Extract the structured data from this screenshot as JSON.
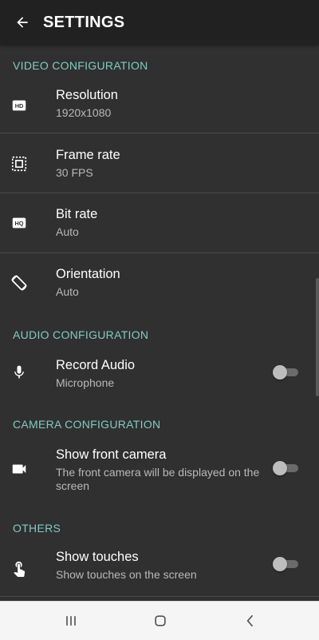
{
  "app_bar": {
    "title": "SETTINGS",
    "back_icon": "arrow-back-icon"
  },
  "sections": {
    "video": {
      "header": "VIDEO CONFIGURATION",
      "items": [
        {
          "title": "Resolution",
          "subtitle": "1920x1080",
          "icon": "hd-icon"
        },
        {
          "title": "Frame rate",
          "subtitle": "30 FPS",
          "icon": "frame-icon"
        },
        {
          "title": "Bit rate",
          "subtitle": "Auto",
          "icon": "hq-icon"
        },
        {
          "title": "Orientation",
          "subtitle": "Auto",
          "icon": "screen-rotation-icon"
        }
      ]
    },
    "audio": {
      "header": "AUDIO CONFIGURATION",
      "items": [
        {
          "title": "Record Audio",
          "subtitle": "Microphone",
          "icon": "mic-icon",
          "toggle": false
        }
      ]
    },
    "camera": {
      "header": "CAMERA CONFIGURATION",
      "items": [
        {
          "title": "Show front camera",
          "subtitle": "The front camera will be displayed on the screen",
          "icon": "videocam-icon",
          "toggle": false
        }
      ]
    },
    "others": {
      "header": "OTHERS",
      "items": [
        {
          "title": "Show touches",
          "subtitle": "Show touches on the screen",
          "icon": "touch-icon",
          "toggle": false
        }
      ]
    }
  },
  "nav_bar": {
    "buttons": [
      "recent-apps-icon",
      "home-icon",
      "back-icon"
    ]
  },
  "colors": {
    "app_bar": "#212121",
    "background": "#303030",
    "section_header": "#80CBC4",
    "subtitle": "#b9b9b9",
    "nav_bar": "#f5f5f5"
  }
}
